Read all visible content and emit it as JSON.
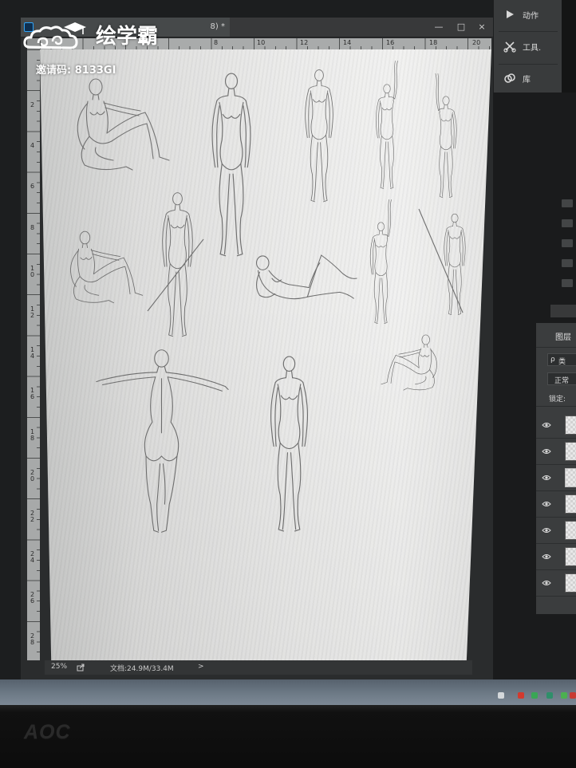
{
  "watermark": {
    "brand": "绘学霸",
    "invite_code": "邀请码: 8133GI",
    "icon": "cloud-logo-icon"
  },
  "document": {
    "tab_title": "8) *",
    "controls": {
      "minimize": "—",
      "maximize": "□",
      "close": "×"
    }
  },
  "rulers": {
    "top": [
      "8",
      "10",
      "12",
      "14",
      "16",
      "18",
      "20"
    ],
    "left": [
      "2",
      "4",
      "6",
      "8",
      "10",
      "12",
      "14",
      "16",
      "18",
      "20",
      "22",
      "24",
      "26",
      "28"
    ]
  },
  "status_bar": {
    "zoom": "25%",
    "doc_info": "文档:24.9M/33.4M",
    "expand": ">"
  },
  "side_panel": {
    "items": [
      {
        "label": "动作",
        "icon": "play-icon"
      },
      {
        "label": "工具.",
        "icon": "tool-presets-icon"
      },
      {
        "label": "库",
        "icon": "libraries-icon"
      }
    ]
  },
  "layers_panel": {
    "tab": "图层",
    "search_symbol": "ρ",
    "filter_kind": "类",
    "blend_mode": "正常",
    "lock_label": "锁定:",
    "layers": [
      {
        "visible": true
      },
      {
        "visible": true
      },
      {
        "visible": true
      },
      {
        "visible": true
      },
      {
        "visible": true
      },
      {
        "visible": true
      },
      {
        "visible": true
      }
    ]
  },
  "monitor": {
    "brand": "AOC"
  },
  "colors": {
    "ui_background": "#2a2c2d",
    "panel": "#3b3d3e",
    "canvas_paper": "#ebebea",
    "sketch_stroke": "#6e6e6e",
    "taskbar": "#6f7c88",
    "watermark": "#ffffff",
    "ps_accent": "#2fa3f7"
  }
}
